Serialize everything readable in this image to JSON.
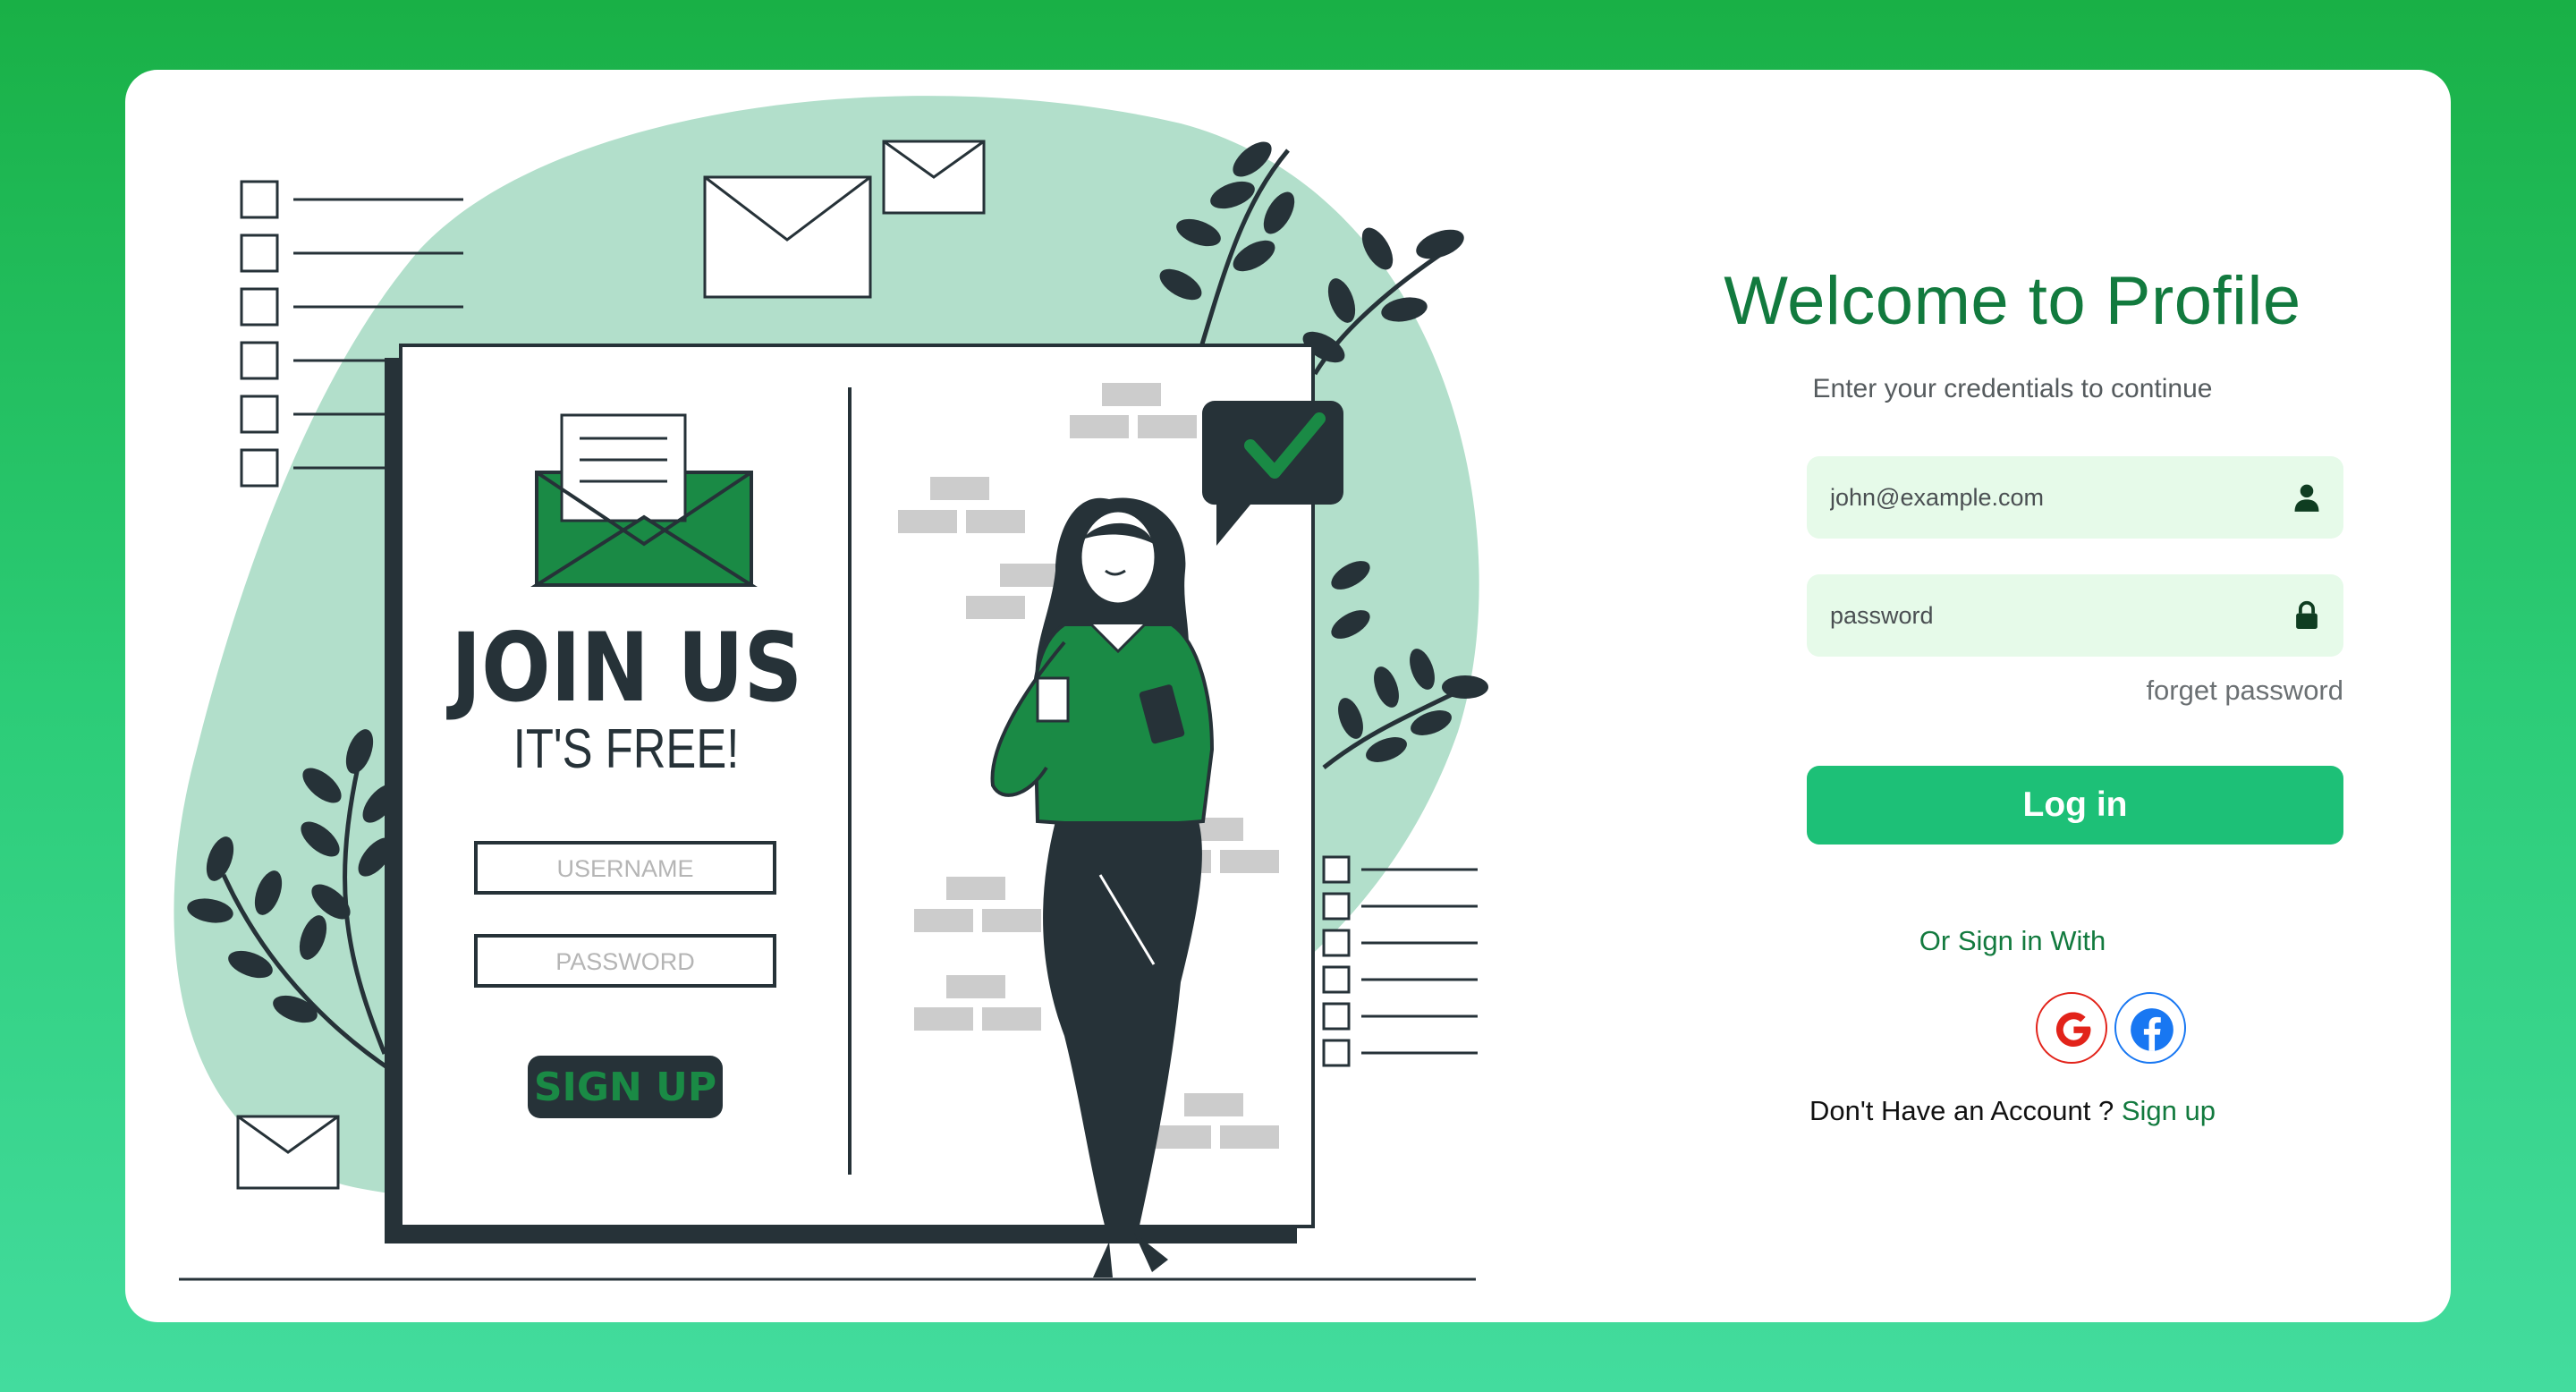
{
  "illustration": {
    "heading": "JOIN US",
    "subheading": "IT'S FREE!",
    "username_placeholder": "USERNAME",
    "password_placeholder": "PASSWORD",
    "signup_button": "SIGN UP"
  },
  "form": {
    "title": "Welcome to Profile",
    "subtitle": "Enter your credentials to continue",
    "email_placeholder": "john@example.com",
    "password_placeholder": "password",
    "forget_password": "forget password",
    "login_button": "Log in",
    "or_sign_in_with": "Or Sign in With",
    "no_account_text": "Don't Have an Account ?",
    "signup_link": "Sign up"
  },
  "icons": {
    "email_field": "user-icon",
    "password_field": "lock-icon",
    "social": [
      "google-icon",
      "facebook-icon"
    ]
  },
  "colors": {
    "page_background": "#19b046",
    "brand_green": "#127a3e",
    "button": "#1dc077",
    "input_background": "#e6fae9",
    "google": "#e2231a",
    "facebook": "#1877f2"
  }
}
